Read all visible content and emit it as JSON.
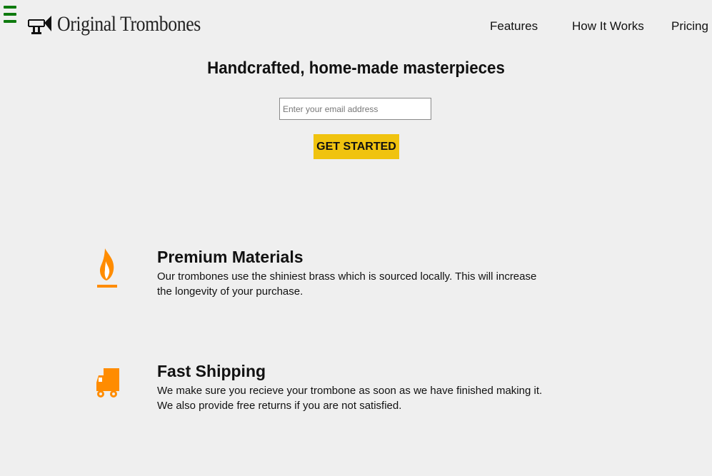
{
  "header": {
    "logo_text": "Original Trombones",
    "nav": [
      {
        "label": "Features"
      },
      {
        "label": "How It Works"
      },
      {
        "label": "Pricing"
      }
    ]
  },
  "hero": {
    "title": "Handcrafted, home-made masterpieces",
    "email_placeholder": "Enter your email address",
    "cta_label": "GET STARTED"
  },
  "features": [
    {
      "icon": "flame-icon",
      "title": "Premium Materials",
      "description": "Our trombones use the shiniest brass which is sourced locally. This will increase the longevity of your purchase."
    },
    {
      "icon": "truck-icon",
      "title": "Fast Shipping",
      "description": "We make sure you recieve your trombone as soon as we have finished making it. We also provide free returns if you are not satisfied."
    }
  ],
  "colors": {
    "background": "#efefef",
    "menu_icon": "#0d7a0d",
    "cta": "#f0c30f",
    "feature_icon": "#ff8c00"
  }
}
